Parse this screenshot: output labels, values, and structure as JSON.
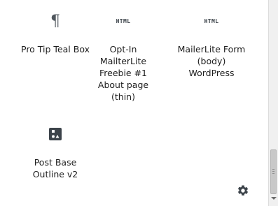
{
  "blocks": [
    {
      "label": "Pro Tip Teal Box",
      "icon": "pilcrow-icon",
      "glyph": "¶"
    },
    {
      "label": "Opt-In\nMailterLite\nFreebie #1\nAbout page\n(thin)",
      "icon": "html-icon",
      "glyph": "HTML"
    },
    {
      "label": "MailerLite Form\n(body)\nWordPress",
      "icon": "html-icon",
      "glyph": "HTML"
    },
    {
      "label": "Post Base\nOutline v2",
      "icon": "reusable-block-icon",
      "glyph": ""
    }
  ],
  "settings_icon": "gear-icon",
  "colors": {
    "icon": "#3c434a",
    "text": "#1e1e1e",
    "scrollbar_track": "#f0f0f0",
    "scrollbar_thumb": "#c8c8c8"
  }
}
